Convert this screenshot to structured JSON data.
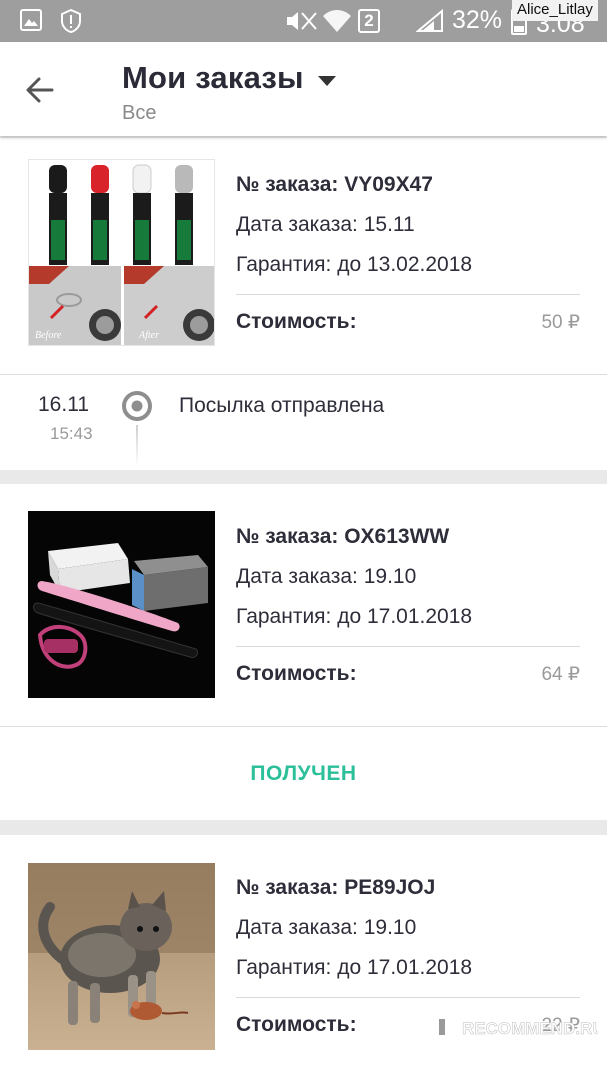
{
  "status_bar": {
    "battery_percent": "32%",
    "time": "3:08",
    "sim_badge": "2",
    "watermark_user": "Alice_Litlay"
  },
  "header": {
    "title": "Мои заказы",
    "filter": "Все"
  },
  "orders": [
    {
      "number_line": "№ заказа: VY09X47",
      "date_line": "Дата заказа: 15.11",
      "warranty_line": "Гарантия: до 13.02.2018",
      "price_label": "Стоимость:",
      "price": "50 ₽",
      "image_labels": [
        "Before",
        "After"
      ],
      "tracking": {
        "date": "16.11",
        "time": "15:43",
        "status": "Посылка отправлена"
      }
    },
    {
      "number_line": "№ заказа: OX613WW",
      "date_line": "Дата заказа: 19.10",
      "warranty_line": "Гарантия: до 17.01.2018",
      "price_label": "Стоимость:",
      "price": "64 ₽",
      "action": "ПОЛУЧЕН"
    },
    {
      "number_line": "№ заказа: PE89JOJ",
      "date_line": "Дата заказа: 19.10",
      "warranty_line": "Гарантия: до 17.01.2018",
      "price_label": "Стоимость:",
      "price": "22 ₽"
    }
  ],
  "watermark": "RECOMMEND.RU",
  "icons": {
    "back": "arrow-left-icon",
    "dropdown": "caret-down-icon",
    "tracking": "radio-dot-icon"
  },
  "colors": {
    "accent": "#2bbf9a",
    "status_bar": "#9e9e9e",
    "text": "#2e2e3a",
    "muted": "#9a9a9a"
  }
}
